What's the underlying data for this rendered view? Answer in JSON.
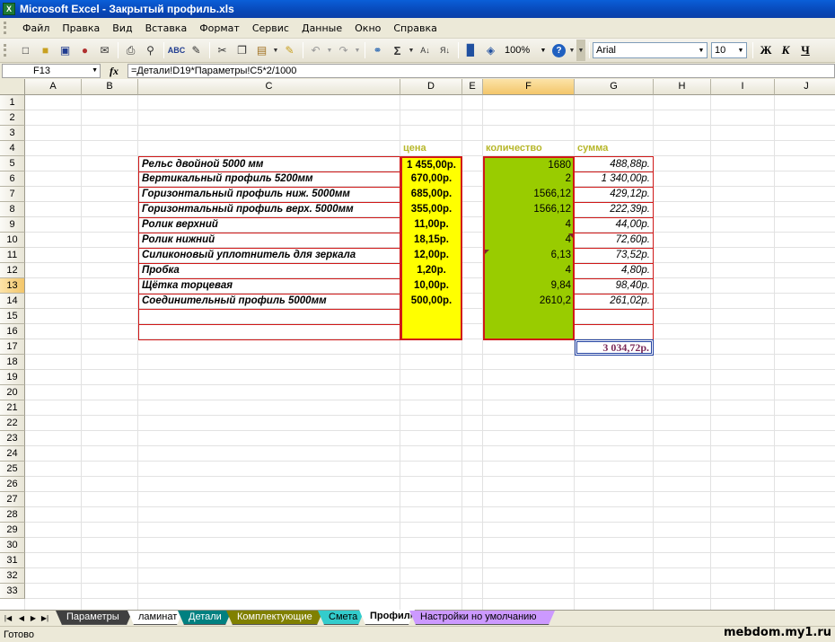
{
  "window": {
    "title": "Microsoft Excel - Закрытый профиль.xls",
    "icon": "excel-icon"
  },
  "menu": [
    "Файл",
    "Правка",
    "Вид",
    "Вставка",
    "Формат",
    "Сервис",
    "Данные",
    "Окно",
    "Справка"
  ],
  "toolbar": {
    "zoom": "100%",
    "font": "Arial",
    "font_size": "10",
    "bold_label": "Ж",
    "italic_label": "К",
    "underline_label": "Ч"
  },
  "formula_bar": {
    "cell_ref": "F13",
    "fx_label": "fx",
    "formula": "=Детали!D19*Параметры!C5*2/1000"
  },
  "columns": [
    "A",
    "B",
    "C",
    "D",
    "E",
    "F",
    "G",
    "H",
    "I",
    "J"
  ],
  "rows": [
    "1",
    "2",
    "3",
    "4",
    "5",
    "6",
    "7",
    "8",
    "9",
    "10",
    "11",
    "12",
    "13",
    "14",
    "15",
    "16",
    "17",
    "18",
    "19",
    "20",
    "21",
    "22",
    "23",
    "24",
    "25",
    "26",
    "27",
    "28",
    "29",
    "30",
    "31",
    "32",
    "33"
  ],
  "sheet": {
    "headers": {
      "price": "цена",
      "qty": "количество",
      "sum": "сумма"
    },
    "items": [
      {
        "name": "Рельс двойной 5000 мм",
        "price": "1 455,00р.",
        "qty": "1680",
        "sum": "488,88р."
      },
      {
        "name": "Вертикальный профиль  5200мм",
        "price": "670,00р.",
        "qty": "2",
        "sum": "1 340,00р."
      },
      {
        "name": "Горизонтальный профиль ниж. 5000мм",
        "price": "685,00р.",
        "qty": "1566,12",
        "sum": "429,12р."
      },
      {
        "name": "Горизонтальный профиль верх. 5000мм",
        "price": "355,00р.",
        "qty": "1566,12",
        "sum": "222,39р."
      },
      {
        "name": "Ролик верхний",
        "price": "11,00р.",
        "qty": "4",
        "sum": "44,00р."
      },
      {
        "name": "Ролик нижний",
        "price": "18,15р.",
        "qty": "4",
        "sum": "72,60р."
      },
      {
        "name": "Силиконовый уплотнитель для зеркала",
        "price": "12,00р.",
        "qty": "6,13",
        "sum": "73,52р."
      },
      {
        "name": "Пробка",
        "price": "1,20р.",
        "qty": "4",
        "sum": "4,80р."
      },
      {
        "name": "Щётка торцевая",
        "price": "10,00р.",
        "qty": "9,84",
        "sum": "98,40р."
      },
      {
        "name": "Соединительный профиль 5000мм",
        "price": "500,00р.",
        "qty": "2610,2",
        "sum": "261,02р."
      },
      {
        "name": "",
        "price": "",
        "qty": "",
        "sum": ""
      },
      {
        "name": "",
        "price": "",
        "qty": "",
        "sum": ""
      }
    ],
    "total": "3 034,72р."
  },
  "tabs": [
    {
      "label": "Параметры",
      "color": "#404040",
      "text_color": "#ffffff"
    },
    {
      "label": "ламинат",
      "color": "#ffffff",
      "text_color": "#000000"
    },
    {
      "label": "Детали",
      "color": "#008080",
      "text_color": "#ffffff"
    },
    {
      "label": "Комплектующие",
      "color": "#808000",
      "text_color": "#ffffff"
    },
    {
      "label": "Смета",
      "color": "#33cccc",
      "text_color": "#000000"
    },
    {
      "label": "Профиль",
      "color": "#ffffff",
      "text_color": "#000000",
      "active": true
    },
    {
      "label": "Настройки но умолчанию",
      "color": "#cc99ff",
      "text_color": "#000000"
    }
  ],
  "status": {
    "text": "Готово",
    "watermark": "mebdom.my1.ru"
  }
}
